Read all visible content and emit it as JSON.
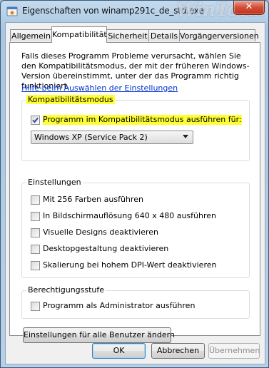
{
  "window": {
    "title": "Eigenschaften von winamp291c_de_std.exe",
    "watermark": "WinTotal",
    "close_label": "✕"
  },
  "tabs": [
    {
      "label": "Allgemein",
      "active": false
    },
    {
      "label": "Kompatibilität",
      "active": true
    },
    {
      "label": "Sicherheit",
      "active": false
    },
    {
      "label": "Details",
      "active": false
    },
    {
      "label": "Vorgängerversionen",
      "active": false
    }
  ],
  "intro_text": "Falls dieses Programm Probleme verursacht, wählen Sie den Kompatibilitätsmodus, der mit der früheren Windows- Version übereinstimmt, unter der das Programm richtig funktioniert.",
  "help_link": "Hilfe beim Auswählen der Einstellungen",
  "compat_mode": {
    "legend": "Kompatibilitätsmodus",
    "checkbox_label": "Programm im Kompatibilitätsmodus ausführen für:",
    "checked": true,
    "selected_os": "Windows XP (Service Pack 2)"
  },
  "settings": {
    "legend": "Einstellungen",
    "items": [
      {
        "label": "Mit 256 Farben ausführen",
        "checked": false
      },
      {
        "label": "In Bildschirmauflösung 640 x 480 ausführen",
        "checked": false
      },
      {
        "label": "Visuelle Designs deaktivieren",
        "checked": false
      },
      {
        "label": "Desktopgestaltung deaktivieren",
        "checked": false
      },
      {
        "label": "Skalierung bei hohem DPI-Wert deaktivieren",
        "checked": false
      }
    ]
  },
  "privilege": {
    "legend": "Berechtigungsstufe",
    "admin_label": "Programm als Administrator ausführen",
    "checked": false
  },
  "all_users_button": "Einstellungen für alle Benutzer ändern",
  "footer": {
    "ok": "OK",
    "cancel": "Abbrechen",
    "apply": "Übernehmen"
  },
  "colors": {
    "highlight": "#ffff33",
    "link": "#0033cc"
  }
}
